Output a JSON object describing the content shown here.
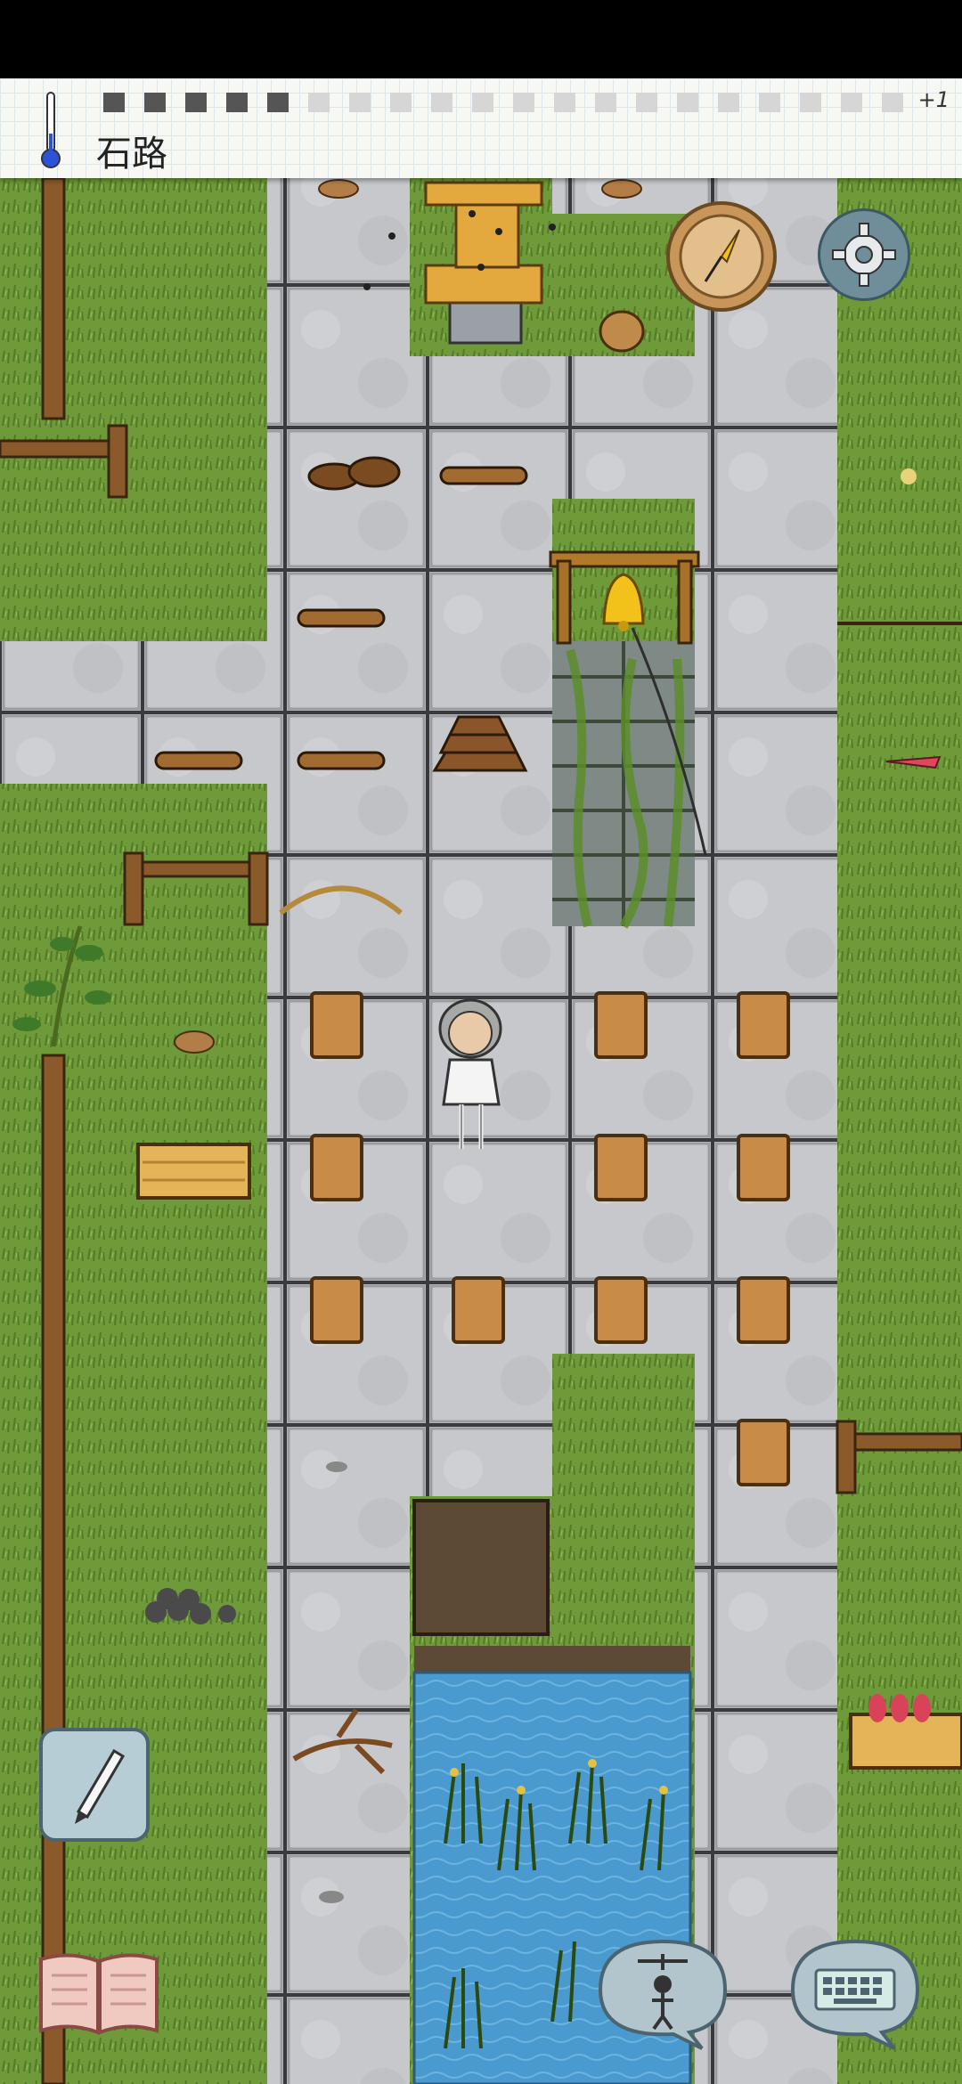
{
  "status": {
    "tile_name": "石路",
    "plus_count": "+1"
  },
  "icons": {
    "thermometer": "thermometer-icon",
    "compass": "compass-icon",
    "settings": "gear-icon",
    "note": "pencil-icon",
    "tech_book": "book-icon",
    "emote": "puppet-icon",
    "keyboard": "keyboard-icon"
  },
  "colors": {
    "grass": "#6f9a3b",
    "stone": "#c7c9cd",
    "water": "#4a9ad0",
    "wood": "#8a5a2b",
    "bell": "#f2c21a"
  }
}
